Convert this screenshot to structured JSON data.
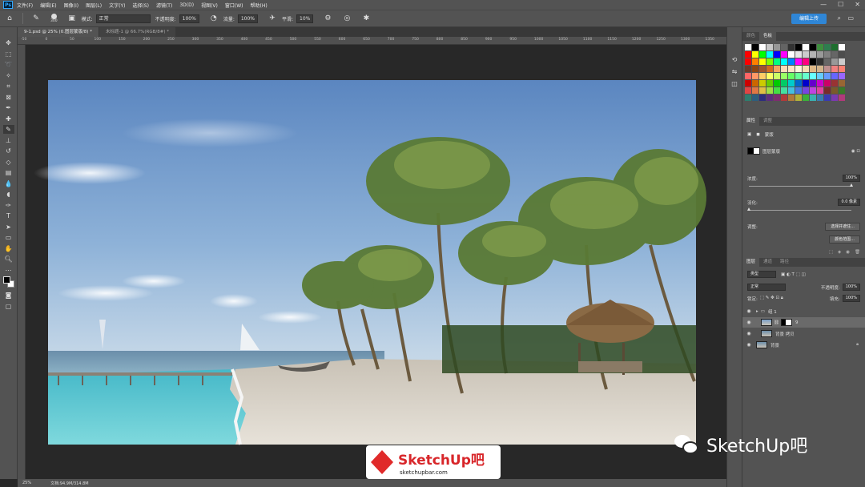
{
  "menubar": {
    "app_icon": "Ps",
    "items": [
      "文件(F)",
      "编辑(E)",
      "图像(I)",
      "图层(L)",
      "文字(Y)",
      "选择(S)",
      "滤镜(T)",
      "3D(D)",
      "视图(V)",
      "窗口(W)",
      "帮助(H)"
    ]
  },
  "options": {
    "brush_size": "300",
    "mode_label": "模式:",
    "mode_value": "正常",
    "opacity_label": "不透明度:",
    "opacity_value": "100%",
    "flow_label": "流量:",
    "flow_value": "100%",
    "smoothing_label": "平滑:",
    "smoothing_value": "10%",
    "share_label": "编辑上传"
  },
  "tabs": [
    {
      "label": "9-1.psd @ 25% (0.图层蒙版/8) *"
    },
    {
      "label": "未标题-1 @ 66.7%(RGB/8#) *"
    }
  ],
  "ruler": {
    "marks": [
      "-50",
      "0",
      "50",
      "100",
      "150",
      "200",
      "250",
      "300",
      "350",
      "400",
      "450",
      "500",
      "550",
      "600",
      "650",
      "700",
      "750",
      "800",
      "850",
      "900",
      "950",
      "1000",
      "1050",
      "1100",
      "1150",
      "1200",
      "1250",
      "1300",
      "1350"
    ]
  },
  "status": {
    "zoom": "25%",
    "doc_size": "文档:94.9M/314.8M"
  },
  "swatches_panel": {
    "tabs": [
      "颜色",
      "色板"
    ],
    "rows": [
      [
        "#ffffff",
        "#000000",
        "#ffffff",
        "#c8c8c8",
        "#969696",
        "#646464",
        "#323232",
        "#000000",
        "#ffffff",
        "#000000",
        "#3e8e3e",
        "#2e7d4f",
        "#1e6e2e",
        "#ffffff"
      ],
      [
        "#ff0000",
        "#ffff00",
        "#00ff00",
        "#00ffff",
        "#0000ff",
        "#ff00ff",
        "#ffffff",
        "#e6e6e6",
        "#cccccc",
        "#b3b3b3",
        "#999999",
        "#808080",
        "#666666",
        "#4d4d4d"
      ],
      [
        "#ff0000",
        "#ff8000",
        "#ffff00",
        "#80ff00",
        "#00ff80",
        "#00ffff",
        "#0080ff",
        "#ff00ff",
        "#ff0080",
        "#000000",
        "#333333",
        "#666666",
        "#999999",
        "#cccccc"
      ],
      [
        "#6b3a2a",
        "#8b4513",
        "#a0522d",
        "#d2691e",
        "#f4a460",
        "#ffdab9",
        "#ffe4c4",
        "#fff8dc",
        "#f5deb3",
        "#deb887",
        "#d2b48c",
        "#bc8f8f",
        "#f08080",
        "#fa8072"
      ],
      [
        "#ff6666",
        "#ff9966",
        "#ffcc66",
        "#ffff66",
        "#ccff66",
        "#99ff66",
        "#66ff66",
        "#66ff99",
        "#66ffcc",
        "#66ffff",
        "#66ccff",
        "#6699ff",
        "#6666ff",
        "#9966ff"
      ],
      [
        "#cc0000",
        "#cc6600",
        "#cccc00",
        "#66cc00",
        "#00cc00",
        "#00cc66",
        "#00cccc",
        "#0066cc",
        "#0000cc",
        "#6600cc",
        "#cc00cc",
        "#cc0066",
        "#993333",
        "#996633"
      ],
      [
        "#e04444",
        "#e07744",
        "#e0c044",
        "#a0e044",
        "#44e044",
        "#44e0a0",
        "#44c0e0",
        "#4477e0",
        "#7744e0",
        "#c044e0",
        "#e044a0",
        "#7a2a2a",
        "#7a5a2a",
        "#3a7a2a"
      ],
      [
        "#2e7d6e",
        "#2e5e7d",
        "#2e2e7d",
        "#5e2e7d",
        "#7d2e6e",
        "#b03a3a",
        "#b07a3a",
        "#b0b03a",
        "#3ab03a",
        "#3ab0b0",
        "#3a7ab0",
        "#3a3ab0",
        "#7a3ab0",
        "#b03a7a"
      ]
    ]
  },
  "properties_panel": {
    "tabs": [
      "属性",
      "调整"
    ],
    "section": "蒙版",
    "mask_label": "图层蒙版",
    "density_label": "浓度:",
    "density_value": "100%",
    "density_level": 1.0,
    "feather_label": "羽化:",
    "feather_value": "0.0 像素",
    "feather_level": 0.0,
    "refine_label": "调整:",
    "select_mask_button": "选择并遮住...",
    "color_range_button": "颜色范围..."
  },
  "layers_panel": {
    "tabs": [
      "图层",
      "通道",
      "路径"
    ],
    "filter_label": "类型",
    "blend_mode": "正常",
    "opacity_label": "不透明度:",
    "opacity_value": "100%",
    "lock_label": "锁定:",
    "fill_label": "填充:",
    "fill_value": "100%",
    "layers": [
      {
        "name": "组 1",
        "type": "group"
      },
      {
        "name": "9",
        "type": "masked",
        "selected": true
      },
      {
        "name": "背景 拷贝",
        "type": "layer"
      },
      {
        "name": "背景",
        "type": "background"
      }
    ]
  },
  "watermark": {
    "logo_text": "SketchUp吧",
    "logo_url": "sketchupbar.com",
    "wechat_label": "SketchUp吧"
  }
}
